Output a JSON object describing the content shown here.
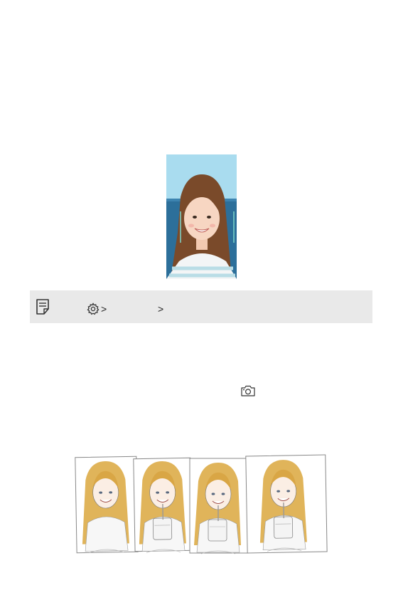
{
  "note": {
    "icon": "note-icon",
    "path_icon": "gear-icon",
    "separators": [
      ">",
      ">"
    ]
  },
  "inline_icon": "camera-icon",
  "figures": {
    "top_figure": "illustration-girl-face-recognition",
    "bottom_figure": "illustration-burst-photo-sequence"
  },
  "colors": {
    "note_background": "#e9e9e9",
    "sky": "#a9dcef",
    "sea": "#2c6f9a",
    "hair": "#7a4a2a",
    "frame_accent": "#7fd6c9"
  }
}
